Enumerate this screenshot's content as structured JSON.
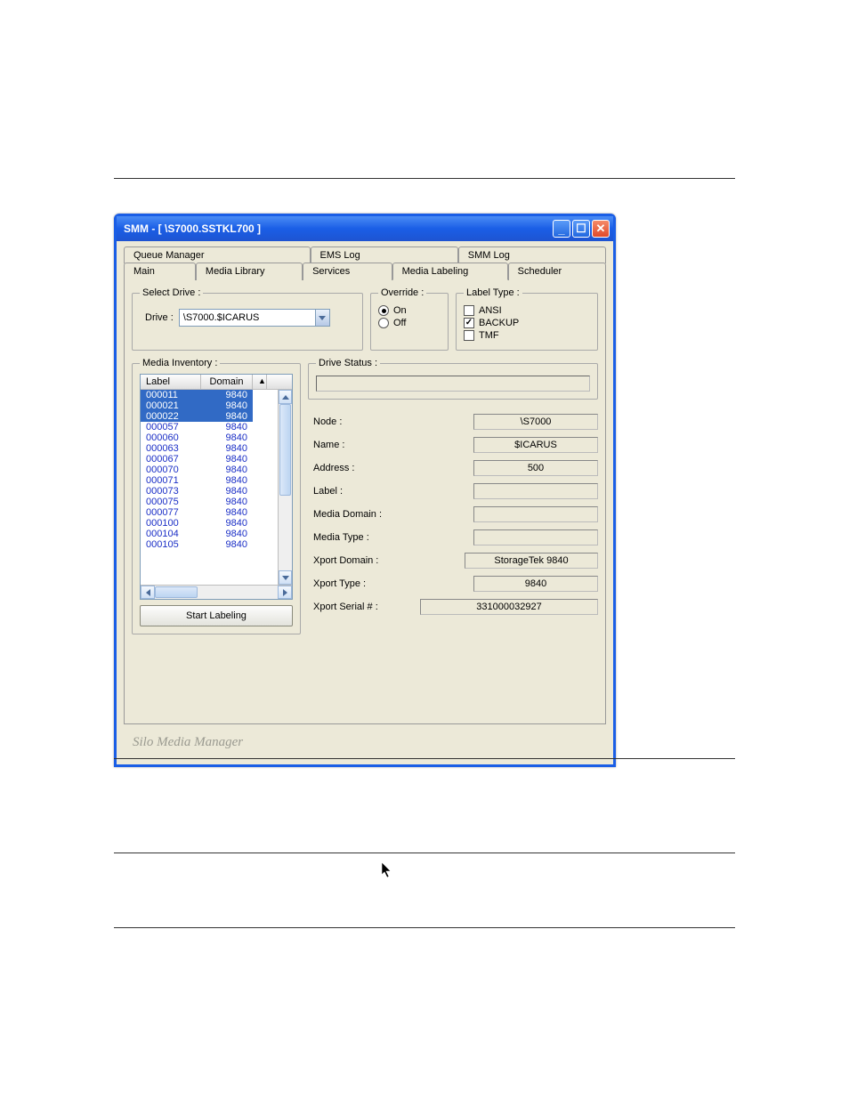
{
  "window": {
    "title": "SMM - [ \\S7000.SSTKL700 ]"
  },
  "tabs_row1": [
    "Queue Manager",
    "EMS Log",
    "SMM Log"
  ],
  "tabs_row2": [
    "Main",
    "Media Library",
    "Services",
    "Media Labeling",
    "Scheduler"
  ],
  "active_tab": "Media Labeling",
  "select_drive": {
    "legend": "Select Drive :",
    "label": "Drive :",
    "value": "\\S7000.$ICARUS"
  },
  "override": {
    "legend": "Override :",
    "on_label": "On",
    "off_label": "Off",
    "selected": "On"
  },
  "label_type": {
    "legend": "Label Type :",
    "options": [
      {
        "label": "ANSI",
        "checked": false
      },
      {
        "label": "BACKUP",
        "checked": true
      },
      {
        "label": "TMF",
        "checked": false
      }
    ]
  },
  "media_inventory": {
    "legend": "Media Inventory :",
    "columns": [
      "Label",
      "Domain"
    ],
    "rows": [
      {
        "label": "000011",
        "domain": "9840",
        "selected": true
      },
      {
        "label": "000021",
        "domain": "9840",
        "selected": true
      },
      {
        "label": "000022",
        "domain": "9840",
        "selected": true
      },
      {
        "label": "000057",
        "domain": "9840",
        "selected": false
      },
      {
        "label": "000060",
        "domain": "9840",
        "selected": false
      },
      {
        "label": "000063",
        "domain": "9840",
        "selected": false
      },
      {
        "label": "000067",
        "domain": "9840",
        "selected": false
      },
      {
        "label": "000070",
        "domain": "9840",
        "selected": false
      },
      {
        "label": "000071",
        "domain": "9840",
        "selected": false
      },
      {
        "label": "000073",
        "domain": "9840",
        "selected": false
      },
      {
        "label": "000075",
        "domain": "9840",
        "selected": false
      },
      {
        "label": "000077",
        "domain": "9840",
        "selected": false
      },
      {
        "label": "000100",
        "domain": "9840",
        "selected": false
      },
      {
        "label": "000104",
        "domain": "9840",
        "selected": false
      },
      {
        "label": "000105",
        "domain": "9840",
        "selected": false
      }
    ]
  },
  "start_button": "Start Labeling",
  "drive_status": {
    "legend": "Drive Status :",
    "value": ""
  },
  "drive_info": [
    {
      "label": "Node :",
      "value": "\\S7000"
    },
    {
      "label": "Name :",
      "value": "$ICARUS"
    },
    {
      "label": "Address :",
      "value": "500"
    },
    {
      "label": "Label :",
      "value": ""
    },
    {
      "label": "Media Domain :",
      "value": ""
    },
    {
      "label": "Media Type :",
      "value": ""
    },
    {
      "label": "Xport Domain :",
      "value": "StorageTek 9840"
    },
    {
      "label": "Xport Type :",
      "value": "9840"
    },
    {
      "label": "Xport Serial # :",
      "value": "331000032927"
    }
  ],
  "footer_brand": "Silo Media Manager"
}
